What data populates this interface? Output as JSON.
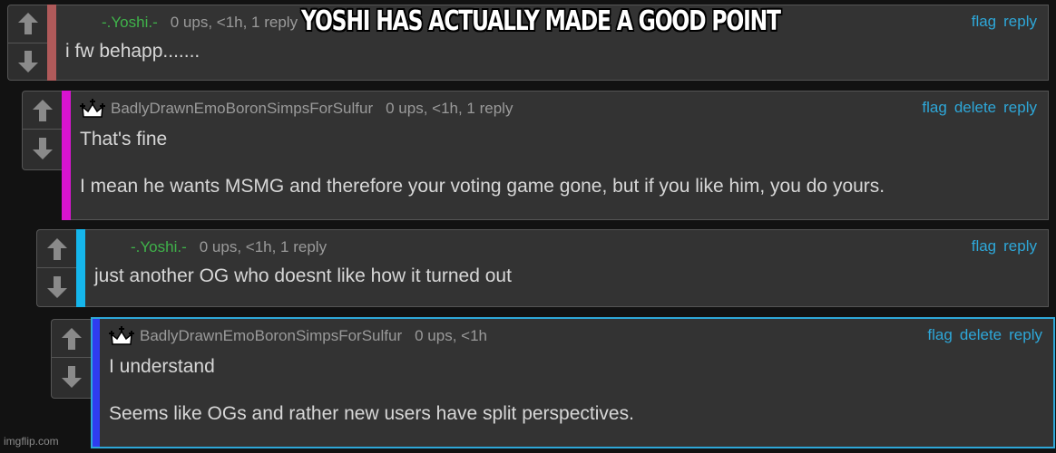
{
  "meme_caption": "YOSHI HAS ACTUALLY MADE A GOOD POINT",
  "watermark": "imgflip.com",
  "colors": {
    "background": "#121212",
    "card": "#333333",
    "username_green": "#3fb24a",
    "meta_gray": "#9a9a9a",
    "action_link": "#2ea7d8",
    "selected_border": "#2ea7d8"
  },
  "comments": [
    {
      "username": "-.Yoshi.-",
      "username_style": "green",
      "has_crown": false,
      "meta": "0 ups, <1h, 1 reply",
      "actions": [
        "flag",
        "reply"
      ],
      "bar_color": "#b05a5a",
      "text": [
        "i fw behapp......."
      ],
      "upvote_icon": "arrow-up-icon",
      "downvote_icon": "arrow-down-icon"
    },
    {
      "username": "BadlyDrawnEmoBoronSimpsForSulfur",
      "username_style": "gray",
      "has_crown": true,
      "meta": "0 ups, <1h, 1 reply",
      "actions": [
        "flag",
        "delete",
        "reply"
      ],
      "bar_color": "#d814d0",
      "text": [
        "That's fine",
        "I mean he wants MSMG and therefore your voting game gone, but if you like him, you do yours."
      ],
      "upvote_icon": "arrow-up-icon",
      "downvote_icon": "arrow-down-icon"
    },
    {
      "username": "-.Yoshi.-",
      "username_style": "green",
      "has_crown": false,
      "meta": "0 ups, <1h, 1 reply",
      "actions": [
        "flag",
        "reply"
      ],
      "bar_color": "#15b6ec",
      "text": [
        "just another OG who doesnt like how it turned out"
      ],
      "upvote_icon": "arrow-up-icon",
      "downvote_icon": "arrow-down-icon"
    },
    {
      "username": "BadlyDrawnEmoBoronSimpsForSulfur",
      "username_style": "gray",
      "has_crown": true,
      "meta": "0 ups, <1h",
      "actions": [
        "flag",
        "delete",
        "reply"
      ],
      "bar_color": "#2f3cf0",
      "selected": true,
      "text": [
        "I understand",
        "Seems like OGs and rather new users have split perspectives."
      ],
      "upvote_icon": "arrow-up-icon",
      "downvote_icon": "arrow-down-icon"
    }
  ]
}
